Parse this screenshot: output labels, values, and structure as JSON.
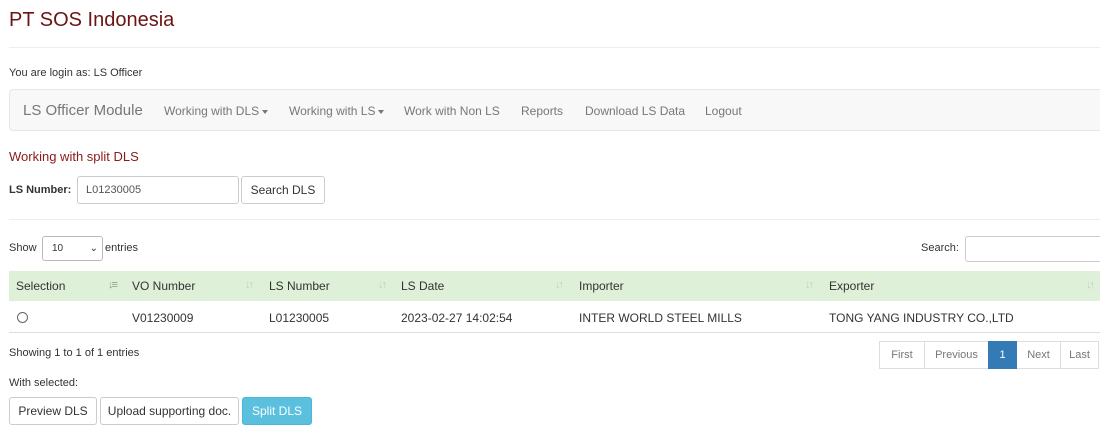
{
  "site": {
    "title": "PT SOS Indonesia",
    "login_text": "You are login as: LS Officer"
  },
  "nav": {
    "brand": "LS Officer Module",
    "items": [
      {
        "label": "Working with DLS",
        "dropdown": true
      },
      {
        "label": "Working with LS",
        "dropdown": true
      },
      {
        "label": "Work with Non LS",
        "dropdown": false
      },
      {
        "label": "Reports",
        "dropdown": false
      },
      {
        "label": "Download LS Data",
        "dropdown": false
      },
      {
        "label": "Logout",
        "dropdown": false
      }
    ]
  },
  "section": {
    "title": "Working with split DLS"
  },
  "ls_search": {
    "label": "LS Number:",
    "value": "L01230005",
    "button": "Search DLS"
  },
  "table_controls": {
    "show": "Show",
    "length_value": "10",
    "entries": "entries",
    "search_label": "Search:"
  },
  "table": {
    "columns": [
      "Selection",
      "VO Number",
      "LS Number",
      "LS Date",
      "Importer",
      "Exporter"
    ],
    "rows": [
      {
        "vo_number": "V01230009",
        "ls_number": "L01230005",
        "ls_date": "2023-02-27 14:02:54",
        "importer": "INTER WORLD STEEL MILLS",
        "exporter": "TONG YANG INDUSTRY CO.,LTD"
      }
    ]
  },
  "info": "Showing 1 to 1 of 1 entries",
  "pagination": {
    "first": "First",
    "previous": "Previous",
    "current": "1",
    "next": "Next",
    "last": "Last"
  },
  "actions": {
    "with_selected": "With selected:",
    "preview": "Preview DLS",
    "upload": "Upload supporting doc.",
    "split": "Split DLS"
  },
  "colors": {
    "title": "#6b1414",
    "header_bg": "#dff0d8",
    "page_active": "#337ab7",
    "split_button": "#5bc0de"
  }
}
